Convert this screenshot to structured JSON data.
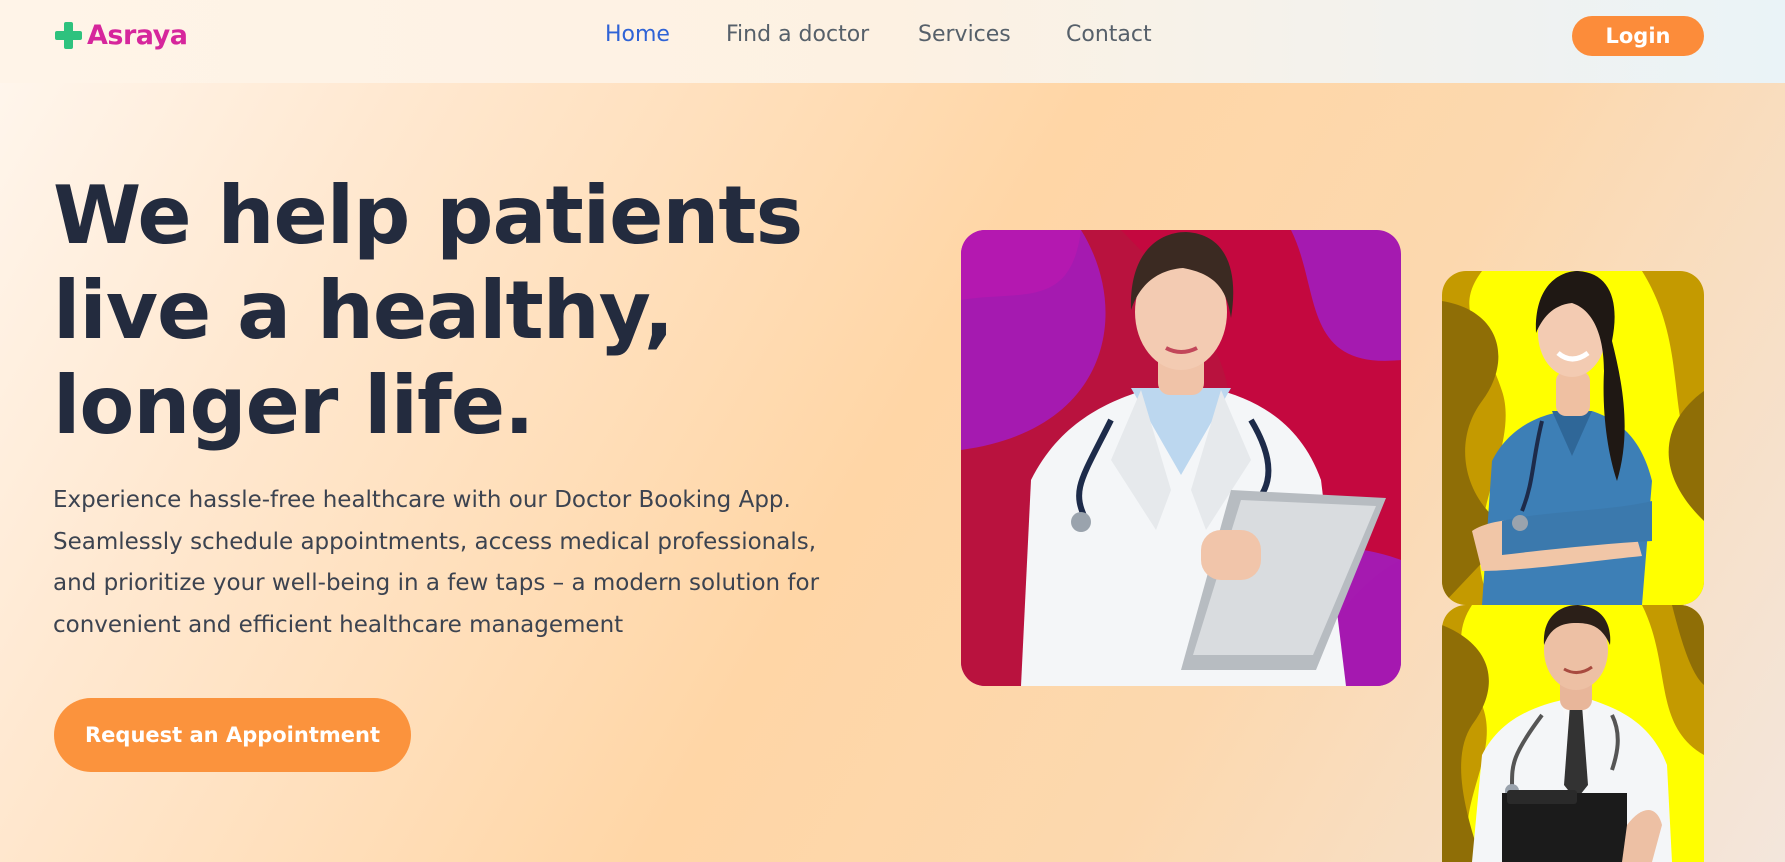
{
  "header": {
    "logo_text": "Asraya",
    "nav": [
      "Home",
      "Find a doctor",
      "Services",
      "Contact"
    ],
    "login_label": "Login"
  },
  "hero": {
    "title": "We help patients live a healthy, longer life.",
    "description": "Experience hassle-free healthcare with our Doctor Booking App. Seamlessly schedule appointments, access medical professionals, and prioritize your well-being in a few taps – a modern solution for convenient and efficient healthcare management",
    "cta_label": "Request an Appointment"
  },
  "colors": {
    "brand": "#d6269c",
    "logo_icon": "#2ec27e",
    "accent": "#fc8c3a",
    "nav_active": "#2f63d6",
    "heading": "#232b3e"
  },
  "images": [
    "female-doctor-with-clipboard-photo",
    "female-nurse-in-scrubs-photo",
    "male-doctor-with-clipboard-photo"
  ]
}
